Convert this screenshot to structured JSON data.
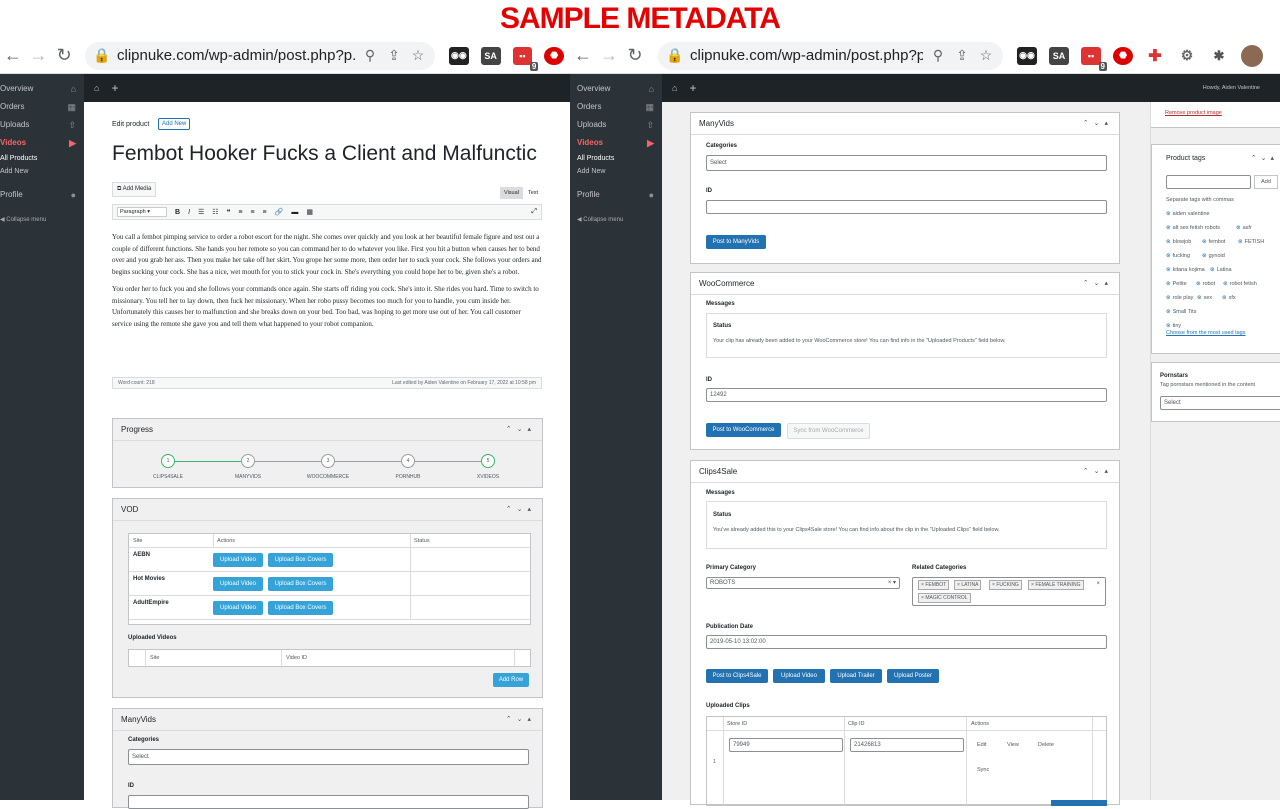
{
  "banner": "SAMPLE METADATA",
  "browser": {
    "url": "clipnuke.com/wp-admin/post.php?p...",
    "url2": "clipnuke.com/wp-admin/post.php?p...",
    "ext_sa": "SA",
    "ext_badge": "9"
  },
  "wp": {
    "howdy": "Howdy, Aiden Valentine"
  },
  "sidebar": {
    "items": [
      {
        "label": "Overview"
      },
      {
        "label": "Orders"
      },
      {
        "label": "Uploads"
      },
      {
        "label": "Videos"
      }
    ],
    "subs": [
      "All Products",
      "Add New"
    ],
    "profile": "Profile",
    "collapse": "Collapse menu"
  },
  "editor": {
    "heading": "Edit product",
    "add_new": "Add New",
    "title": "Fembot Hooker Fucks a Client and Malfunctic",
    "add_media": "Add Media",
    "tab_visual": "Visual",
    "tab_text": "Text",
    "format": "Paragraph",
    "para1": "You call a fembot pimping service to order a robot escort for the night. She comes over quickly and you look at her beautiful female figure and test out a couple of different functions. She hands you her remote so you can command her to do whatever you like. First you hit a button when causes her to bend over and you grab her ass. Then you make her take off her skirt. You grope her some more, then order her to suck your cock. She follows your orders and begins sucking your cock. She has a nice, wet mouth for you to stick your cock in. She's everything you could hope her to be, given she's a robot.",
    "para2": "You order her to fuck you and she follows your commands once again. She starts off riding you cock. She's into it. She rides you hard. Time to switch to missionary. You tell her to lay down, then fuck her missionary. When her robo pussy becomes too much for you to handle, you cum inside her. Unfortunately this causes her to malfunction and she breaks down on your bed. Too bad, was hoping to get more use out of her. You call customer service using the remote she gave you and tell them what happened to your robot companion.",
    "word_count": "Word count: 218",
    "last_edited": "Last edited by Aiden Valentine on February 17, 2022 at 10:58 pm"
  },
  "progress": {
    "title": "Progress",
    "steps": [
      {
        "n": "1",
        "label": "CLIPS4SALE"
      },
      {
        "n": "2",
        "label": "MANYVIDS"
      },
      {
        "n": "3",
        "label": "WOOCOMMERCE"
      },
      {
        "n": "4",
        "label": "PORNHUB"
      },
      {
        "n": "5",
        "label": "XVIDEOS"
      }
    ]
  },
  "vod": {
    "title": "VOD",
    "cols": [
      "Site",
      "Actions",
      "Status"
    ],
    "rows": [
      {
        "site": "AEBN"
      },
      {
        "site": "Hot Movies"
      },
      {
        "site": "AdultEmpire"
      }
    ],
    "upload_video": "Upload Video",
    "upload_box": "Upload Box Covers",
    "uploaded_title": "Uploaded Videos",
    "up_cols": [
      "Site",
      "Video ID"
    ],
    "add_row": "Add Row"
  },
  "manyvids": {
    "title": "ManyVids",
    "categories": "Categories",
    "select": "Select",
    "id": "ID",
    "post_btn": "Post to ManyVids"
  },
  "woo": {
    "title": "WooCommerce",
    "messages": "Messages",
    "status": "Status",
    "status_text": "Your clip has already been added to your WooCommerce store! You can find info in the \"Uploaded Products\" field below.",
    "id": "ID",
    "id_val": "12492",
    "post_btn": "Post to WooCommerce",
    "sync_btn": "Sync from WooCommerce"
  },
  "c4s": {
    "title": "Clips4Sale",
    "messages": "Messages",
    "status": "Status",
    "status_text": "You've already added this to your Clips4Sale store! You can find info about the clip in the \"Uploaded Clips\" field below.",
    "primary": "Primary Category",
    "primary_val": "ROBOTS",
    "related": "Related Categories",
    "related_tags": [
      "FEMBOT",
      "LATINA",
      "FUCKING",
      "FEMALE TRAINING",
      "MAGIC CONTROL"
    ],
    "pubdate": "Publication Date",
    "pubdate_val": "2019-05-10 13:02:00",
    "btns": [
      "Post to Clips4Sale",
      "Upload Video",
      "Upload Trailer",
      "Upload Poster"
    ],
    "uploaded": "Uploaded Clips",
    "cols": [
      "Store ID",
      "Clip ID",
      "Actions"
    ],
    "row_n": "1",
    "store_id": "79949",
    "clip_id": "21426813",
    "actions": [
      "Edit",
      "View",
      "Delete",
      "Sync"
    ]
  },
  "right": {
    "remove_img": "Remove product image",
    "tags_title": "Product tags",
    "add": "Add",
    "sep": "Separate tags with commas",
    "tags": [
      "aiden valentine",
      "alt sex fetish robots",
      "asfr",
      "blowjob",
      "fembot",
      "FETISH",
      "fucking",
      "gynoid",
      "kitana kojima",
      "Latina",
      "Petite",
      "robot",
      "robot fetish",
      "role play",
      "sex",
      "sfx",
      "Small Tits",
      "tiny"
    ],
    "choose": "Choose from the most used tags",
    "pornstars": "Pornstars",
    "pornstars_desc": "Tag pornstars mentioned in the content",
    "select": "Select"
  }
}
